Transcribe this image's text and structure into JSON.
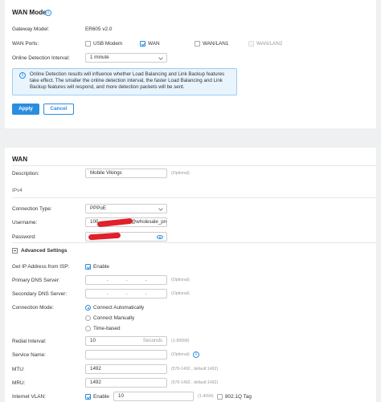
{
  "wan_mode": {
    "title": "WAN Mode",
    "gateway_model_label": "Gateway Model:",
    "gateway_model_value": "ER605 v2.0",
    "wan_ports_label": "WAN Ports:",
    "ports": [
      {
        "label": "USB Modem",
        "checked": false,
        "disabled": false
      },
      {
        "label": "WAN",
        "checked": true,
        "disabled": false
      },
      {
        "label": "WAN/LAN1",
        "checked": false,
        "disabled": false
      },
      {
        "label": "WAN/LAN2",
        "checked": false,
        "disabled": true
      }
    ],
    "detection_interval_label": "Online Detection Interval:",
    "detection_interval_value": "1 minute",
    "info_text": "Online Detection results will influence whether Load Balancing and Link Backup features take effect. The smaller the online detection interval, the faster Load Balancing and Link Backup features will respond, and more detection packets will be sent.",
    "apply_label": "Apply",
    "cancel_label": "Cancel"
  },
  "wan": {
    "title": "WAN",
    "description_label": "Description:",
    "description_value": "Mobile Vikings",
    "optional": "(Optional)",
    "ipv4_label": "IPv4",
    "connection_type_label": "Connection Type:",
    "connection_type_value": "PPPoE",
    "username_label": "Username:",
    "username_prefix": "100",
    "username_suffix": "@wholesale_pro",
    "password_label": "Password:",
    "advanced_label": "Advanced Settings",
    "get_ip_label": "Get IP Address from ISP:",
    "enable_label": "Enable",
    "primary_dns_label": "Primary DNS Server:",
    "secondary_dns_label": "Secondary DNS Server:",
    "connection_mode_label": "Connection Mode:",
    "modes": [
      "Connect Automatically",
      "Connect Manually",
      "Time-based"
    ],
    "redial_label": "Redial Interval:",
    "redial_value": "10",
    "redial_unit": "Seconds",
    "redial_range": "(1-99999)",
    "service_name_label": "Service Name:",
    "mtu_label": "MTU:",
    "mtu_value": "1492",
    "mtu_range": "(576-1492 , default:1492)",
    "mru_label": "MRU:",
    "mru_value": "1492",
    "mru_range": "(576-1492 , default:1492)",
    "vlan_label": "Internet VLAN:",
    "vlan_enable_label": "Enable",
    "vlan_value": "10",
    "vlan_range": "(1-4094)",
    "vlan_8021q_label": "802.1Q Tag"
  },
  "colors": {
    "accent": "#2b8de0",
    "redaction": "#e0202a",
    "info_bg": "#e9f4fd"
  }
}
